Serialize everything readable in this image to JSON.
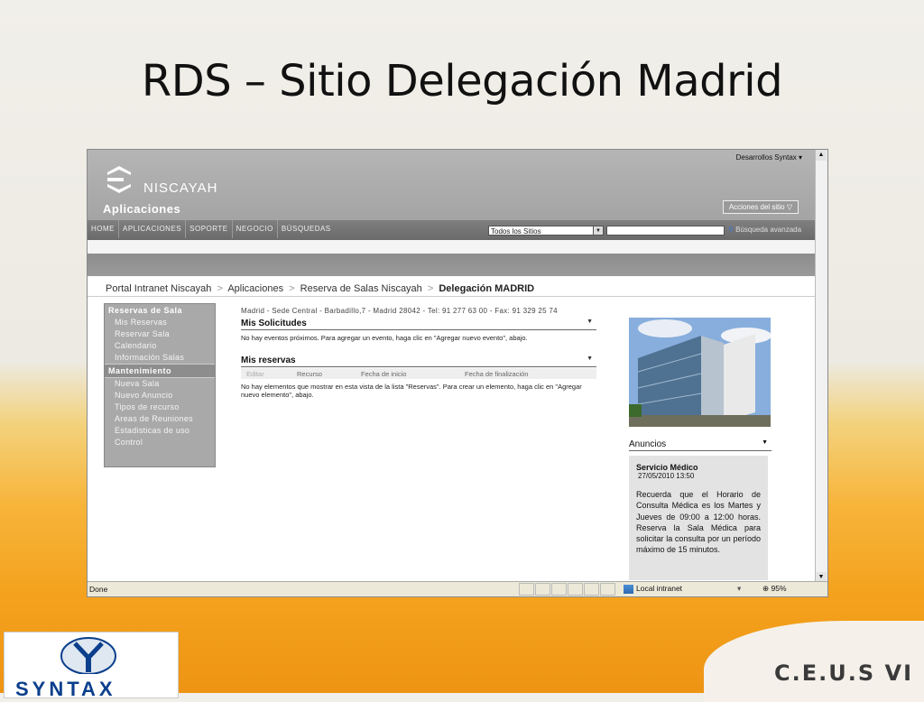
{
  "slide": {
    "title": "RDS – Sitio Delegación Madrid"
  },
  "browser": {
    "user_menu": "Desarrollos Syntax ▾",
    "logo_text": "NISCAYAH",
    "apps_title": "Aplicaciones",
    "site_actions": "Acciones del sitio ▽",
    "top_nav": [
      "HOME",
      "APLICACIONES",
      "SOPORTE",
      "NEGOCIO",
      "BÚSQUEDAS"
    ],
    "search_scope": "Todos los Sitios",
    "advanced_search": "Búsqueda avanzada",
    "breadcrumb": {
      "items": [
        "Portal Intranet Niscayah",
        "Aplicaciones",
        "Reserva de Salas Niscayah"
      ],
      "current": "Delegación MADRID",
      "separator": ">"
    },
    "sidebar": {
      "section1": "Reservas de Sala",
      "section1_items": [
        "Mis Reservas",
        "Reservar Sala",
        "Calendario",
        "Información Salas"
      ],
      "section2": "Mantenimiento",
      "section2_items": [
        "Nueva Sala",
        "Nuevo Anuncio",
        "Tipos de recurso",
        "Areas de Reuniones",
        "Estadisticas de uso",
        "Control"
      ]
    },
    "main": {
      "address": "Madrid - Sede Central - Barbadillo,7 - Madrid 28042 - Tel: 91 277 63 00 - Fax: 91 329 25 74",
      "solicitudes_title": "Mis Solicitudes",
      "solicitudes_text": "No hay eventos próximos. Para agregar un evento, haga clic en \"Agregar nuevo evento\", abajo.",
      "reservas_title": "Mis reservas",
      "columns": [
        "Editar",
        "Recurso",
        "Fecha de inicio",
        "Fecha de finalización"
      ],
      "reservas_text": "No hay elementos que mostrar en esta vista de la lista \"Reservas\". Para crear un elemento, haga clic en \"Agregar nuevo elemento\", abajo."
    },
    "announcements": {
      "title": "Anuncios",
      "item_title": "Servicio Médico",
      "item_date": "27/05/2010 13:50",
      "item_body": "Recuerda que el Horario de Consulta Médica es los Martes y Jueves de 09:00 a 12:00 horas. Reserva la Sala Médica para solicitar la consulta por un período máximo de 15 minutos."
    },
    "status": {
      "done": "Done",
      "zone": "Local intranet",
      "zoom": "95%"
    }
  },
  "footer": {
    "syntax_logo": "SYNTAX",
    "ceus_logo": "C.E.U.S VI"
  }
}
